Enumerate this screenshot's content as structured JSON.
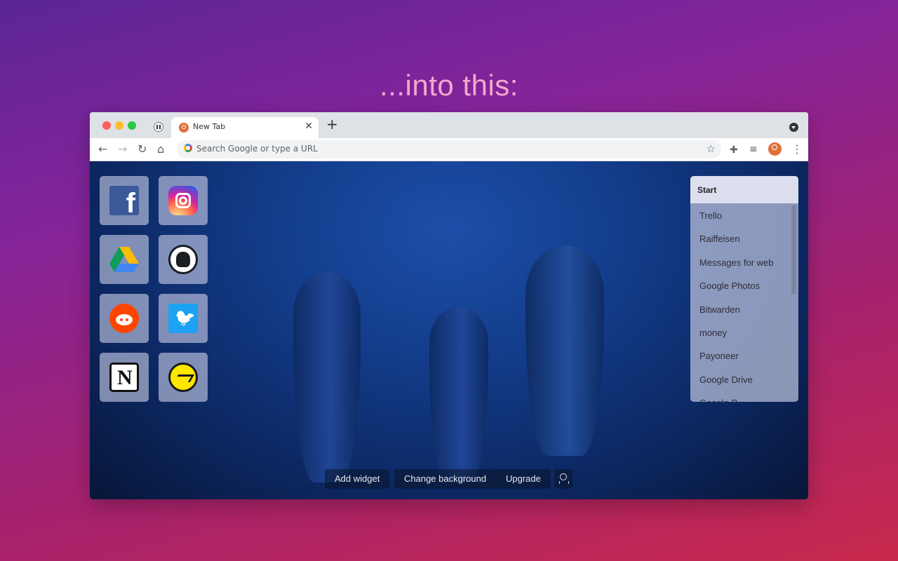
{
  "headline": "...into this:",
  "browser": {
    "tab_title": "New Tab",
    "tab_close": "✕",
    "new_tab": "+",
    "omnibox_placeholder": "Search Google or type a URL",
    "nav": {
      "back": "←",
      "forward": "→",
      "reload": "↻",
      "home": "⌂",
      "star": "☆",
      "menu": "⋮"
    }
  },
  "shortcuts": [
    {
      "name": "Facebook",
      "icon": "facebook-icon"
    },
    {
      "name": "Instagram",
      "icon": "instagram-icon"
    },
    {
      "name": "Google Drive",
      "icon": "google-drive-icon"
    },
    {
      "name": "GitHub",
      "icon": "github-icon"
    },
    {
      "name": "Reddit",
      "icon": "reddit-icon"
    },
    {
      "name": "Twitter",
      "icon": "twitter-icon"
    },
    {
      "name": "Notion",
      "icon": "notion-icon"
    },
    {
      "name": "Basecamp",
      "icon": "basecamp-icon"
    }
  ],
  "start_panel": {
    "title": "Start",
    "items": [
      "Trello",
      "Raiffeisen",
      "Messages for web",
      "Google Photos",
      "Bitwarden",
      "money",
      "Payoneer",
      "Google Drive",
      "Google P..."
    ]
  },
  "bottom_bar": {
    "add_widget": "Add widget",
    "change_background": "Change background",
    "upgrade": "Upgrade"
  },
  "colors": {
    "bg_gradient_start": "#5b2596",
    "bg_gradient_end": "#c8284c",
    "headline": "#f6a6cc",
    "ocean": "#143f8f"
  }
}
